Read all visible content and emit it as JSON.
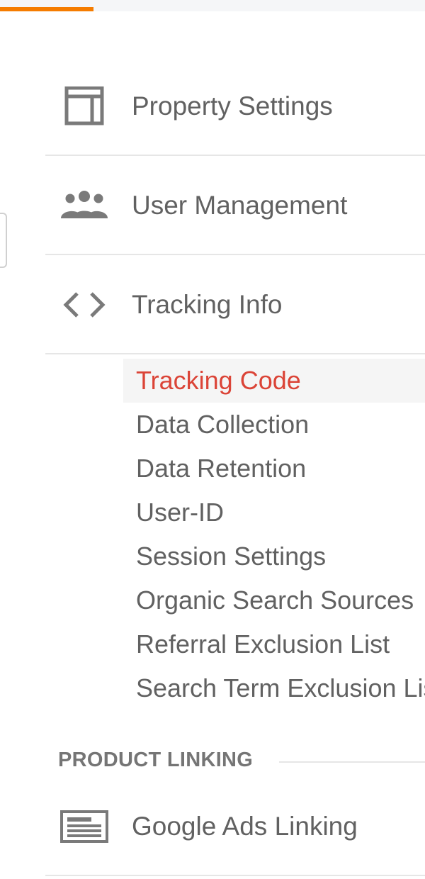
{
  "nav": {
    "items": [
      {
        "label": "Property Settings",
        "icon": "layout-icon"
      },
      {
        "label": "User Management",
        "icon": "people-icon"
      },
      {
        "label": "Tracking Info",
        "icon": "code-icon"
      }
    ]
  },
  "tracking_sub": {
    "items": [
      {
        "label": "Tracking Code",
        "active": true
      },
      {
        "label": "Data Collection"
      },
      {
        "label": "Data Retention"
      },
      {
        "label": "User-ID"
      },
      {
        "label": "Session Settings"
      },
      {
        "label": "Organic Search Sources"
      },
      {
        "label": "Referral Exclusion List"
      },
      {
        "label": "Search Term Exclusion List"
      }
    ]
  },
  "product_linking": {
    "header": "PRODUCT LINKING",
    "items": [
      {
        "label": "Google Ads Linking",
        "icon": "ads-icon"
      }
    ]
  },
  "colors": {
    "accent": "#f57c00",
    "active_text": "#db4437",
    "text": "#616161",
    "icon": "#7a7a7a"
  }
}
